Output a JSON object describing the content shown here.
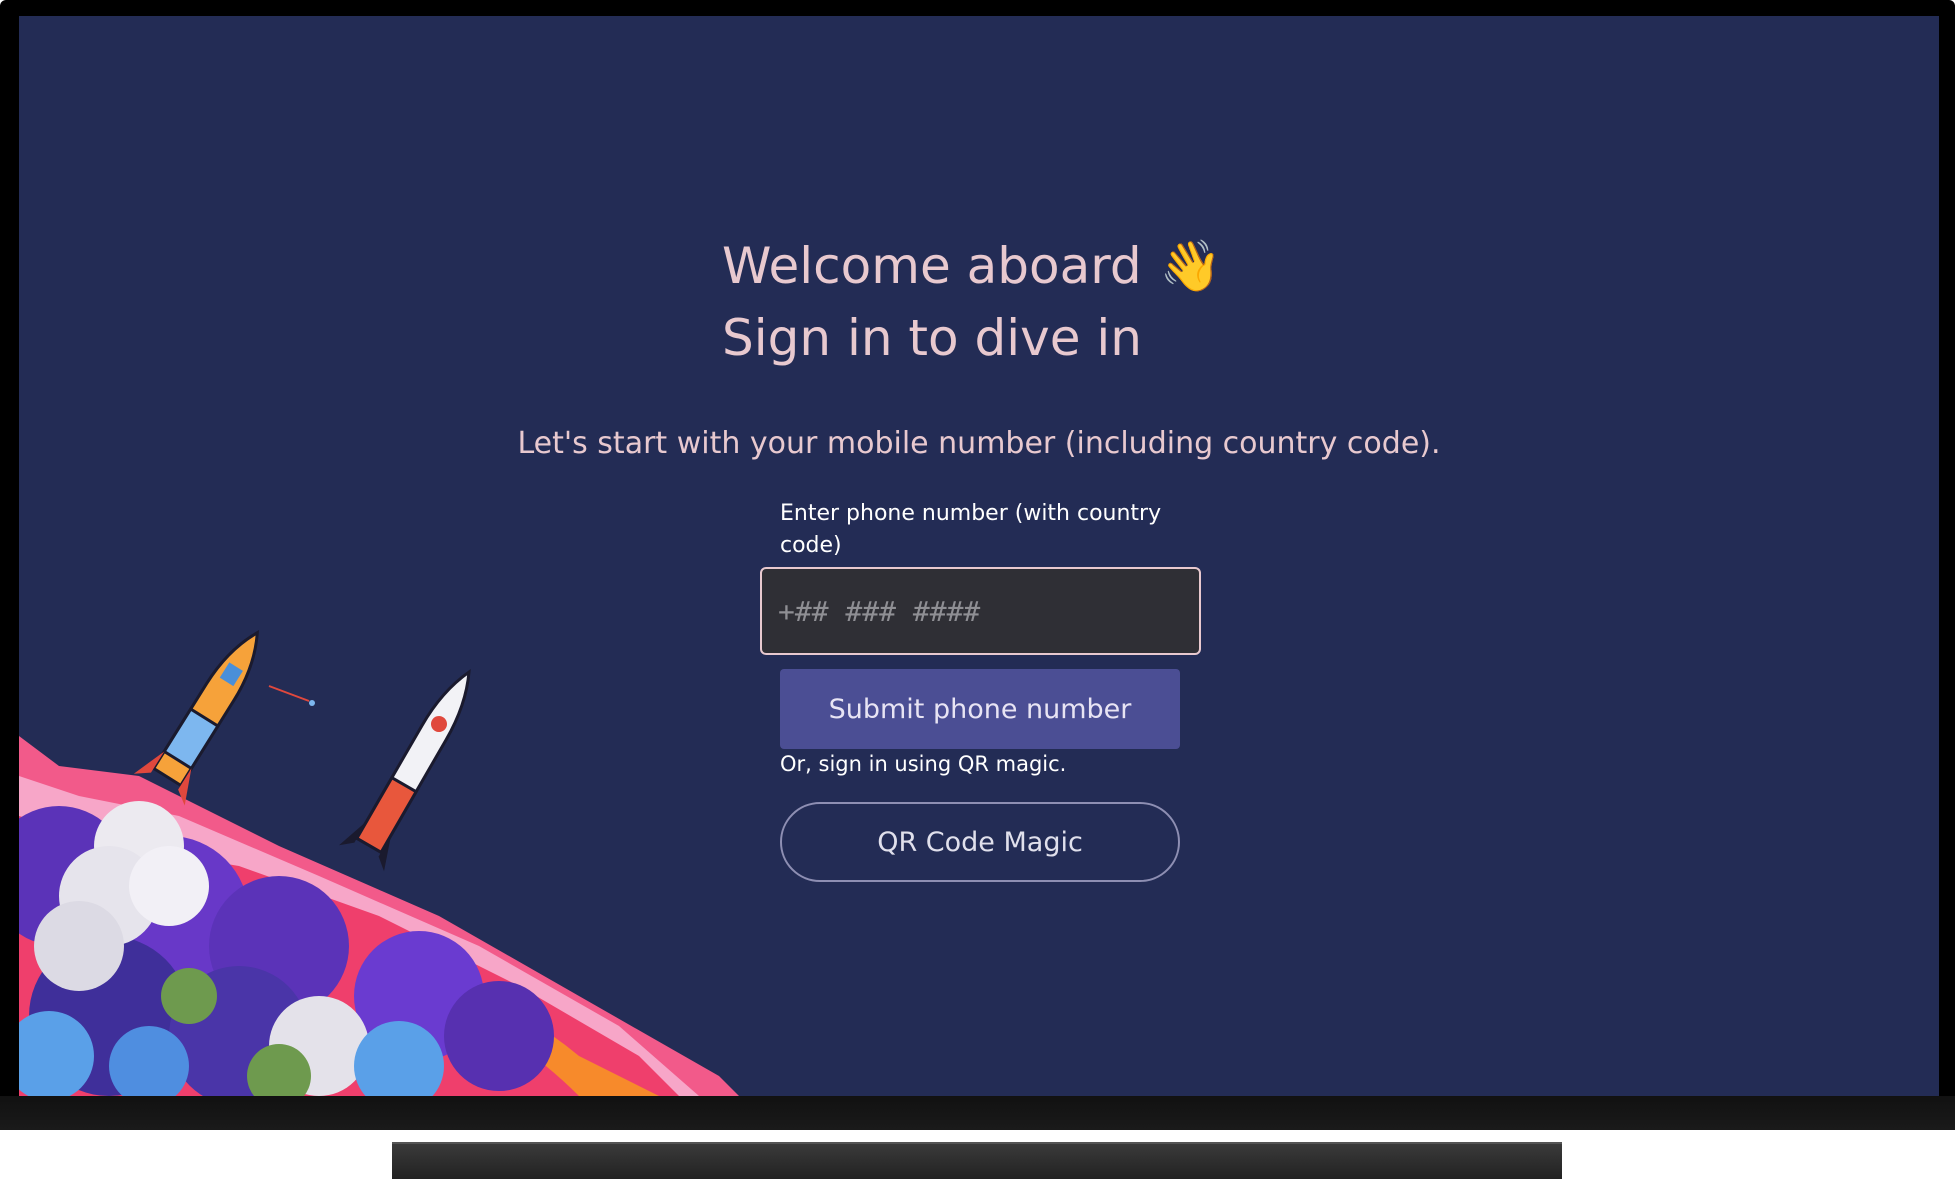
{
  "welcome": {
    "line1": "Welcome aboard",
    "wave_emoji": "👋",
    "line2": "Sign in to dive in"
  },
  "intro_text": "Let's start with your mobile number (including country code).",
  "phone_field": {
    "label": "Enter phone number (with country code)",
    "placeholder": "+## ### ####",
    "value": ""
  },
  "submit_label": "Submit phone number",
  "alt_sign_in_text": "Or, sign in using QR magic.",
  "qr_button_label": "QR Code Magic",
  "colors": {
    "background": "#232c55",
    "text_pink": "#e8c9cf",
    "submit_button": "#4b4e94",
    "input_background": "#2f2f35"
  },
  "illustration": {
    "icon": "rocket-launch-illustration"
  }
}
